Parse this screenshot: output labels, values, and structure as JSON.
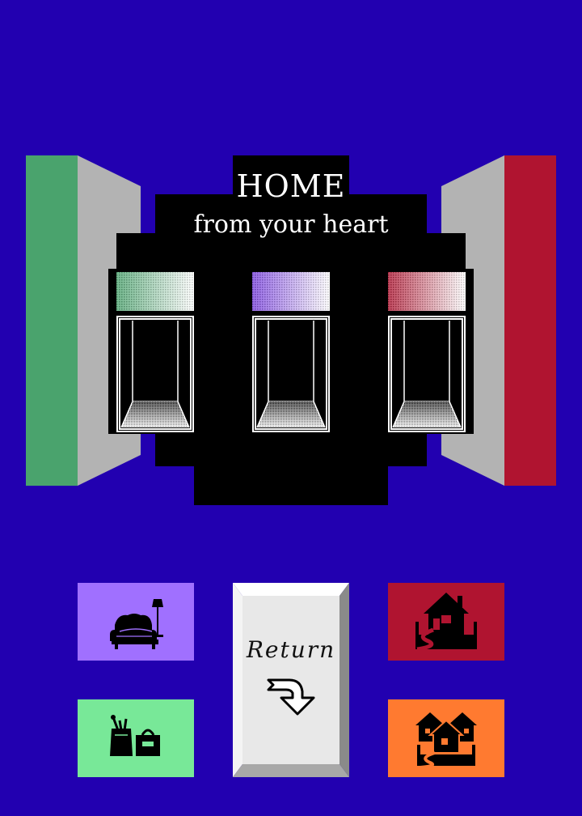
{
  "header": {
    "title": "HOME",
    "subtitle": "from your heart"
  },
  "colors": {
    "background": "#2200b0",
    "left_panel": "#4aa36d",
    "right_panel": "#b01430",
    "panel_side": "#b3b3b3",
    "tile_furniture": "#a070ff",
    "tile_house": "#b01430",
    "tile_shopping": "#78e898",
    "tile_neighborhood": "#ff7a30",
    "return_button": "#e8e8e8"
  },
  "doors": [
    {
      "name": "green-door",
      "swatch_color": "#4aa36d"
    },
    {
      "name": "purple-door",
      "swatch_color": "#7a40e0"
    },
    {
      "name": "red-door",
      "swatch_color": "#b01430"
    }
  ],
  "tiles": {
    "furniture_icon": "sofa-lamp-icon",
    "house_icon": "house-road-icon",
    "shopping_icon": "shopping-bags-icon",
    "neighborhood_icon": "houses-road-icon"
  },
  "return_button": {
    "label": "Return",
    "icon": "curved-arrow-icon"
  }
}
